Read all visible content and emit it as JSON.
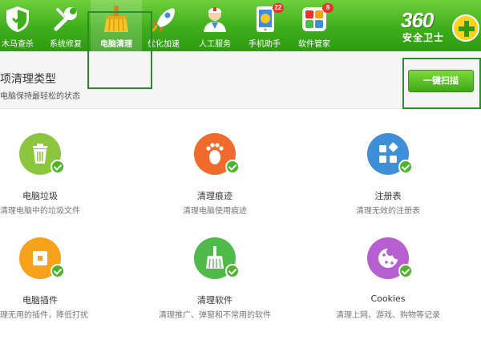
{
  "toolbar": {
    "items": [
      {
        "label": "木马查杀",
        "icon": "shield-icon"
      },
      {
        "label": "系统修复",
        "icon": "wrench-icon"
      },
      {
        "label": "电脑清理",
        "icon": "broom-icon",
        "active": true
      },
      {
        "label": "优化加速",
        "icon": "rocket-icon"
      },
      {
        "label": "人工服务",
        "icon": "doctor-icon"
      },
      {
        "label": "手机助手",
        "icon": "phone-icon",
        "badge": "22"
      },
      {
        "label": "软件管家",
        "icon": "apps-icon",
        "badge": "8"
      }
    ],
    "logo": {
      "number": "360",
      "text": "安全卫士"
    }
  },
  "header": {
    "title": "项清理类型",
    "subtitle": "电脑保持最轻松的状态",
    "scan_button": "一键扫描"
  },
  "items": [
    {
      "name": "电脑垃圾",
      "desc": "清理电脑中的垃圾文件",
      "icon": "trash-icon",
      "color": "#8cc63f"
    },
    {
      "name": "清理痕迹",
      "desc": "清理电脑使用痕迹",
      "icon": "footprint-icon",
      "color": "#f06a2c"
    },
    {
      "name": "注册表",
      "desc": "清理无效的注册表",
      "icon": "registry-icon",
      "color": "#3e8fd8"
    },
    {
      "name": "电脑插件",
      "desc": "清理无用的插件，降低打扰",
      "icon": "plugin-icon",
      "color": "#f7a21b"
    },
    {
      "name": "清理软件",
      "desc": "清理推广、弹窗和不常用的软件",
      "icon": "broom-icon",
      "color": "#4fb94a"
    },
    {
      "name": "Cookies",
      "desc": "清理上网、游戏、购物等记录",
      "icon": "cookie-icon",
      "color": "#b65fd0"
    }
  ],
  "colors": {
    "brand_green": "#3fae1c",
    "check_green": "#4cb52b"
  }
}
